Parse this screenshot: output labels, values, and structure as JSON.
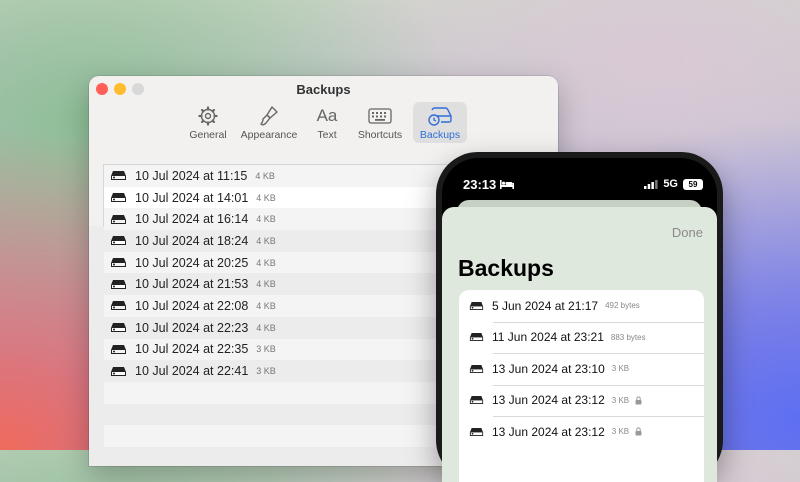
{
  "mac": {
    "window_title": "Backups",
    "toolbar": [
      {
        "key": "general",
        "label": "General",
        "icon": "gear-icon"
      },
      {
        "key": "appearance",
        "label": "Appearance",
        "icon": "paintbrush-icon"
      },
      {
        "key": "text",
        "label": "Text",
        "icon": "text-aa-icon",
        "glyph": "Aa"
      },
      {
        "key": "shortcuts",
        "label": "Shortcuts",
        "icon": "keyboard-icon"
      },
      {
        "key": "backups",
        "label": "Backups",
        "icon": "backup-drive-icon",
        "selected": true
      }
    ],
    "backups": [
      {
        "date": "10 Jul 2024 at 11:15",
        "size": "4 KB"
      },
      {
        "date": "10 Jul 2024 at 14:01",
        "size": "4 KB"
      },
      {
        "date": "10 Jul 2024 at 16:14",
        "size": "4 KB"
      },
      {
        "date": "10 Jul 2024 at 18:24",
        "size": "4 KB"
      },
      {
        "date": "10 Jul 2024 at 20:25",
        "size": "4 KB"
      },
      {
        "date": "10 Jul 2024 at 21:53",
        "size": "4 KB"
      },
      {
        "date": "10 Jul 2024 at 22:08",
        "size": "4 KB"
      },
      {
        "date": "10 Jul 2024 at 22:23",
        "size": "4 KB"
      },
      {
        "date": "10 Jul 2024 at 22:35",
        "size": "3 KB"
      },
      {
        "date": "10 Jul 2024 at 22:41",
        "size": "3 KB"
      }
    ]
  },
  "phone": {
    "status": {
      "time": "23:13",
      "network": "5G",
      "battery": "59"
    },
    "done_label": "Done",
    "title": "Backups",
    "backups": [
      {
        "date": "5 Jun 2024 at 21:17",
        "size": "492 bytes",
        "locked": false
      },
      {
        "date": "11 Jun 2024 at 23:21",
        "size": "883 bytes",
        "locked": false
      },
      {
        "date": "13 Jun 2024 at 23:10",
        "size": "3 KB",
        "locked": false
      },
      {
        "date": "13 Jun 2024 at 23:12",
        "size": "3 KB",
        "locked": true
      },
      {
        "date": "13 Jun 2024 at 23:12",
        "size": "3 KB",
        "locked": true
      }
    ]
  },
  "colors": {
    "accent": "#2f6fd9",
    "traffic_red": "#ff5f57",
    "traffic_yellow": "#febc2e"
  }
}
